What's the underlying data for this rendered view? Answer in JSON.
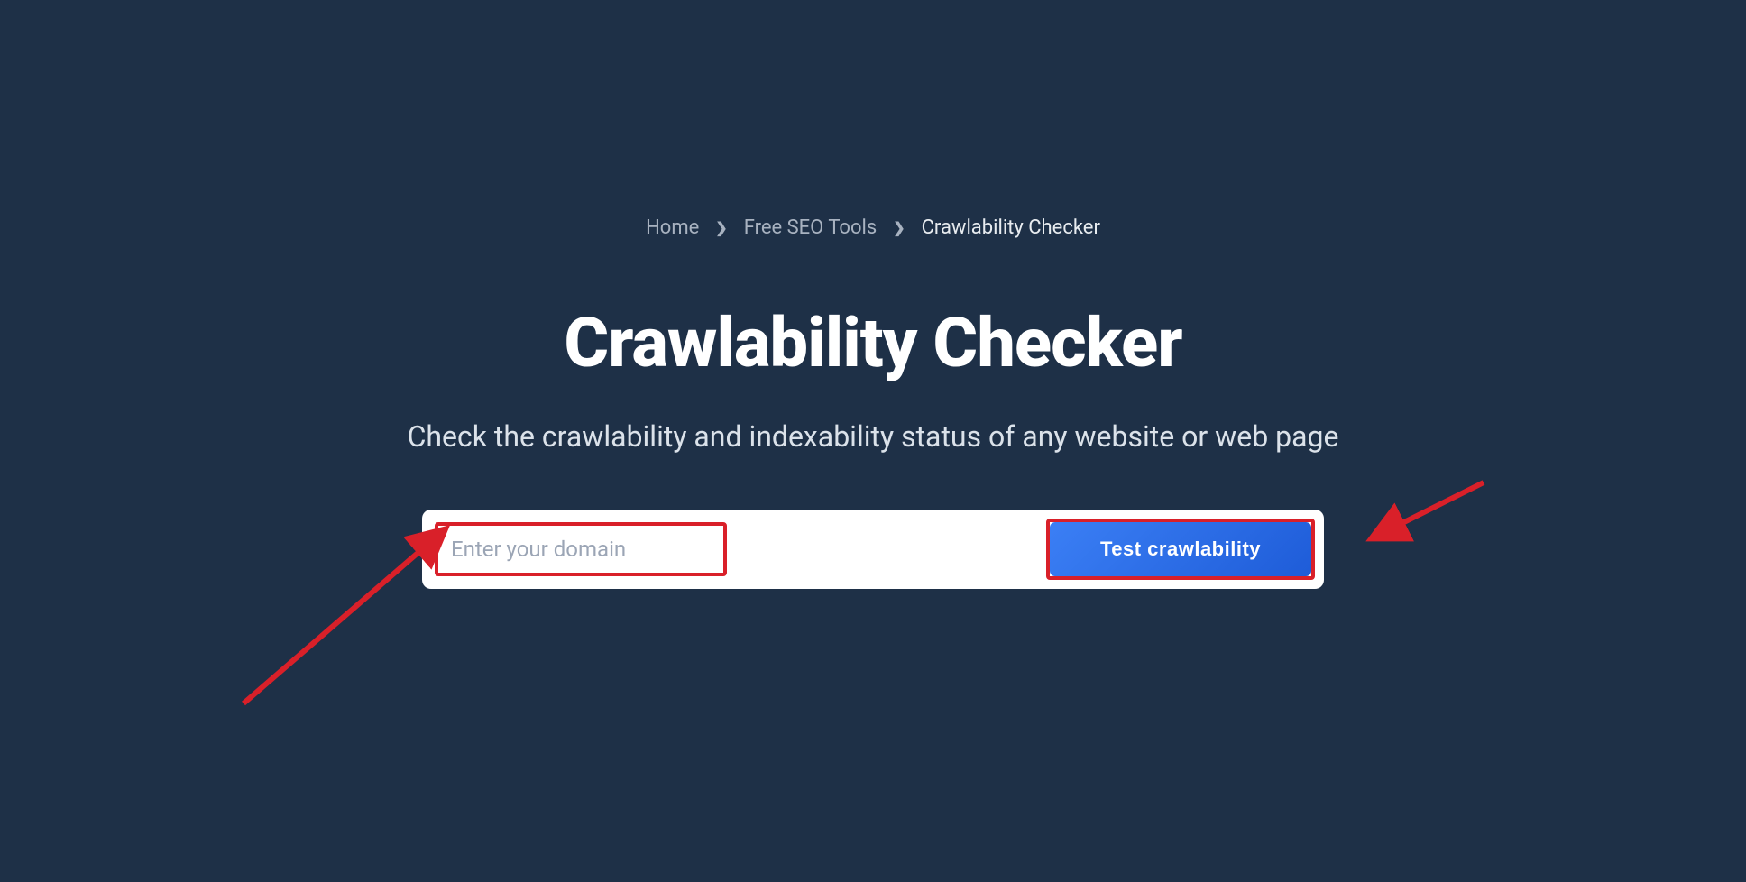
{
  "breadcrumb": {
    "items": [
      {
        "label": "Home"
      },
      {
        "label": "Free SEO Tools"
      },
      {
        "label": "Crawlability Checker"
      }
    ]
  },
  "page": {
    "title": "Crawlability Checker",
    "subtitle": "Check the crawlability and indexability status of any website or web page"
  },
  "form": {
    "input_placeholder": "Enter your domain",
    "input_value": "",
    "button_label": "Test crawlability"
  },
  "colors": {
    "background": "#1e3047",
    "accent": "#2b6be0",
    "highlight_border": "#d92029"
  }
}
